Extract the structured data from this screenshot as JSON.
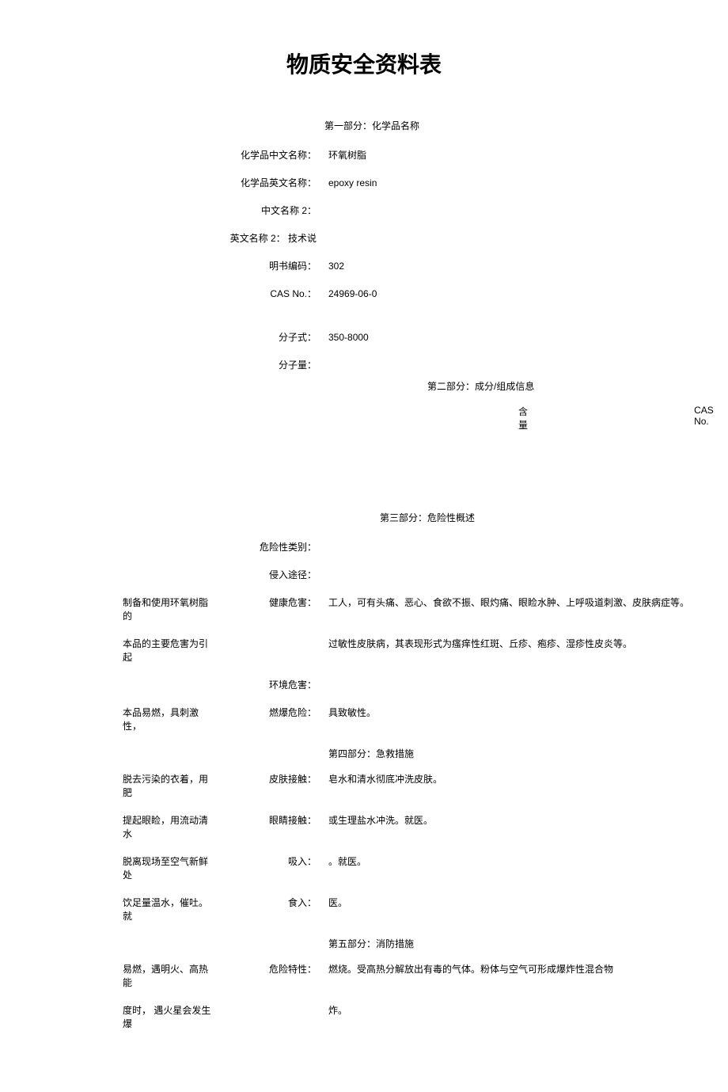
{
  "title": "物质安全资料表",
  "sections": {
    "s1": "第一部分：化学品名称",
    "s2": "第二部分：成分/组成信息",
    "s3": "第三部分：危险性概述",
    "s4": "第四部分：急救措施",
    "s5": "第五部分：消防措施"
  },
  "part1": {
    "chinese_name_label": "化学品中文名称：",
    "chinese_name_value": "环氧树脂",
    "english_name_label": "化学品英文名称：",
    "english_name_value": "epoxy resin",
    "chinese_name2_label": "中文名称 2：",
    "chinese_name2_value": "",
    "english_name2_label": "英文名称 2： 技术说",
    "english_name2_value": "",
    "manual_code_label": "明书编码：",
    "manual_code_value": "302",
    "cas_label": "CAS No.：",
    "cas_value": "24969-06-0",
    "formula_label": "分子式：",
    "formula_value": "",
    "weight_label": "分子量：",
    "weight_value": "350-8000"
  },
  "part2": {
    "content_label": "含量",
    "cas_label": "CAS No."
  },
  "part3": {
    "hazard_category_label": "危险性类别：",
    "invasion_label": "侵入途径：",
    "health_left": "制备和使用环氧树脂的",
    "health_label": "健康危害：",
    "health_value": "工人，可有头痛、恶心、食欲不振、眼灼痛、眼睑水肿、上呼吸道刺激、皮肤病症等。",
    "health_left2": "本品的主要危害为引起",
    "health_value2": "过敏性皮肤病，其表现形式为瘙痒性红斑、丘疹、疱疹、湿疹性皮炎等。",
    "env_label": "环境危害：",
    "fire_left": "本品易燃，具刺激性，",
    "fire_label": "燃爆危险：",
    "fire_value": "具致敏性。"
  },
  "part4": {
    "skin_left": "脱去污染的衣着，用肥",
    "skin_label": "皮肤接触：",
    "skin_value": "皂水和清水彻底冲洗皮肤。",
    "eye_left": "提起眼睑，用流动清水",
    "eye_label": "眼睛接触：",
    "eye_value": "或生理盐水冲洗。就医。",
    "inhale_left": "脱离现场至空气新鲜处",
    "inhale_label": "吸入：",
    "inhale_value": "。就医。",
    "ingest_left": "饮足量温水，催吐。就",
    "ingest_label": "食入：",
    "ingest_value": "医。"
  },
  "part5": {
    "danger_left": "易燃，遇明火、高热能",
    "danger_label": "危险特性：",
    "danger_value": "燃烧。受高热分解放出有毒的气体。粉体与空气可形成爆炸性混合物",
    "danger_left2": "度时， 遇火星会发生爆",
    "danger_value2": "炸。"
  }
}
